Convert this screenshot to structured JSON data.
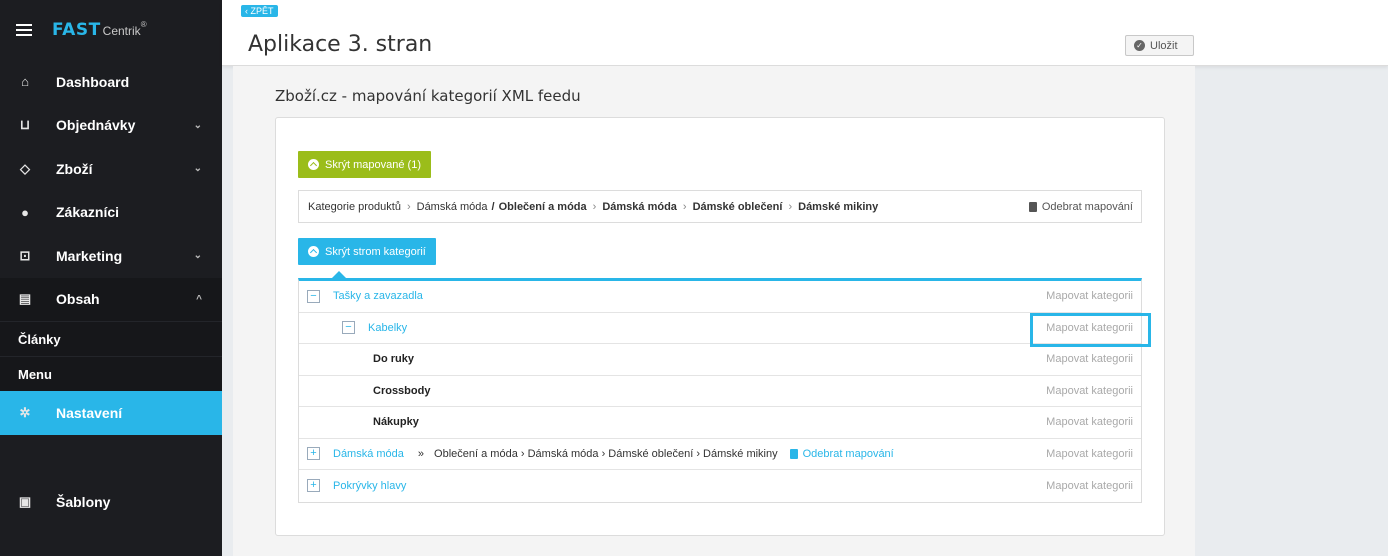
{
  "brand": {
    "name": "FAST",
    "suffix": "Centrik",
    "reg": "®"
  },
  "sidebar": {
    "items": [
      {
        "label": "Dashboard",
        "icon": "home-icon",
        "chevron": ""
      },
      {
        "label": "Objednávky",
        "icon": "cart-icon",
        "chevron": "⌄"
      },
      {
        "label": "Zboží",
        "icon": "tag-icon",
        "chevron": "⌄"
      },
      {
        "label": "Zákazníci",
        "icon": "users-icon",
        "chevron": ""
      },
      {
        "label": "Marketing",
        "icon": "presentation-icon",
        "chevron": "⌄"
      },
      {
        "label": "Obsah",
        "icon": "document-icon",
        "chevron": "^"
      }
    ],
    "subitems": [
      {
        "label": "Články"
      },
      {
        "label": "Menu"
      }
    ],
    "selected": {
      "label": "Nastavení",
      "icon": "gear-icon"
    },
    "templates": {
      "label": "Šablony",
      "icon": "image-icon"
    }
  },
  "header": {
    "back": "‹ ZPĚT",
    "title": "Aplikace 3. stran",
    "save_label": "Uložit"
  },
  "section": {
    "title": "Zboží.cz - mapování kategorií XML feedu",
    "hide_mapped_label": "Skrýt mapované (1)",
    "hide_tree_label": "Skrýt strom kategorií"
  },
  "breadcrumb": {
    "root": "Kategorie produktů",
    "level1": "Dámská móda",
    "slash": "/",
    "path": [
      "Oblečení a móda",
      "Dámská móda",
      "Dámské oblečení",
      "Dámské mikiny"
    ],
    "remove_label": "Odebrat mapování"
  },
  "tree": {
    "map_label": "Mapovat kategorii",
    "rows": [
      {
        "label": "Tašky a zavazadla",
        "toggle": "−"
      },
      {
        "label": "Kabelky",
        "toggle": "−"
      },
      {
        "label": "Do ruky"
      },
      {
        "label": "Crossbody"
      },
      {
        "label": "Nákupky"
      },
      {
        "label": "Dámská móda",
        "toggle": "+",
        "arrow": "»",
        "mapped": "Oblečení a móda  ›  Dámská móda  ›  Dámské oblečení  ›  Dámské mikiny",
        "remove": "Odebrat mapování"
      },
      {
        "label": "Pokrývky hlavy",
        "toggle": "+"
      }
    ]
  },
  "colors": {
    "accent": "#29b6e8",
    "green": "#9bbd1a",
    "sidebar": "#1c1d21"
  }
}
